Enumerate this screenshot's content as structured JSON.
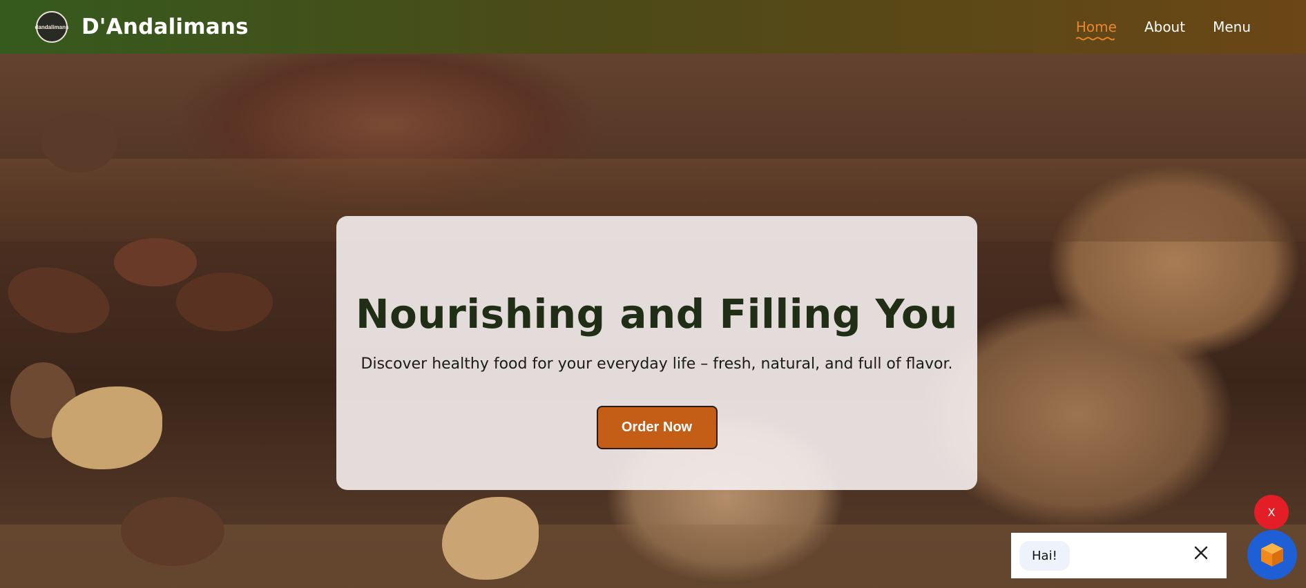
{
  "header": {
    "brand": "D'Andalimans",
    "logo_text": "dandalimans",
    "nav": [
      {
        "label": "Home",
        "active": true
      },
      {
        "label": "About",
        "active": false
      },
      {
        "label": "Menu",
        "active": false
      }
    ]
  },
  "hero": {
    "title": "Nourishing and Filling You",
    "subtitle": "Discover healthy food for your everyday life – fresh, natural, and full of flavor.",
    "cta_label": "Order Now"
  },
  "chat": {
    "close_label": "X",
    "greeting": "Hai!",
    "launcher_icon": "cube-icon"
  },
  "colors": {
    "header_start": "#355a1e",
    "header_end": "#6b4616",
    "active_nav": "#e8862b",
    "cta_bg": "#c45d16",
    "title_color": "#1f2e14",
    "chat_close_bg": "#e41e26",
    "chat_launcher_bg": "#1f5fd6"
  }
}
